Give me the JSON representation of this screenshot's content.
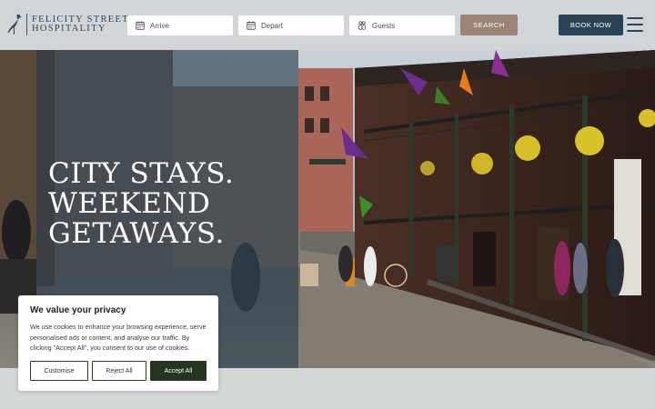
{
  "brand": {
    "line1": "Felicity Street",
    "line2": "Hospitality"
  },
  "booking": {
    "arrive": "Arrive",
    "depart": "Depart",
    "guests": "Guests",
    "search_label": "Search"
  },
  "header": {
    "book_now_label": "Book Now"
  },
  "hero": {
    "headline": [
      "City Stays.",
      "Weekend",
      "Getaways."
    ]
  },
  "cookie_banner": {
    "title": "We value your privacy",
    "body": "We use cookies to enhance your browsing experience, serve personalised ads or content, and analyse our traffic. By clicking \"Accept All\", you consent to our use of cookies.",
    "customise_label": "Customise",
    "reject_label": "Reject All",
    "accept_label": "Accept All"
  },
  "colors": {
    "header_bg": "#d2d5d7",
    "brand_navy": "#2b4356",
    "search_taupe": "#9c8476",
    "accept_green": "#253620"
  }
}
